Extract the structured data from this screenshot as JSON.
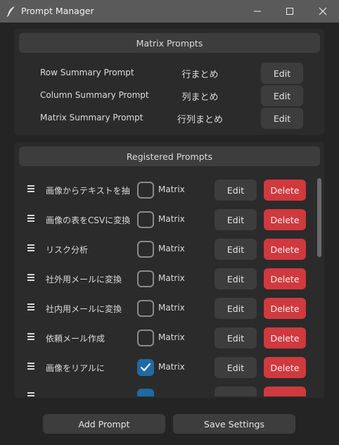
{
  "window": {
    "title": "Prompt Manager"
  },
  "matrix_section": {
    "title": "Matrix Prompts",
    "rows": [
      {
        "label": "Row Summary Prompt",
        "short": "行まとめ",
        "edit_label": "Edit"
      },
      {
        "label": "Column Summary Prompt",
        "short": "列まとめ",
        "edit_label": "Edit"
      },
      {
        "label": "Matrix Summary Prompt",
        "short": "行列まとめ",
        "edit_label": "Edit"
      }
    ]
  },
  "registered_section": {
    "title": "Registered Prompts",
    "prompts": [
      {
        "name": "画像からテキストを抽",
        "matrix_checked": false,
        "matrix_label": "Matrix",
        "edit_label": "Edit",
        "delete_label": "Delete"
      },
      {
        "name": "画像の表をCSVに変換",
        "matrix_checked": false,
        "matrix_label": "Matrix",
        "edit_label": "Edit",
        "delete_label": "Delete"
      },
      {
        "name": "リスク分析",
        "matrix_checked": false,
        "matrix_label": "Matrix",
        "edit_label": "Edit",
        "delete_label": "Delete"
      },
      {
        "name": "社外用メールに変換",
        "matrix_checked": false,
        "matrix_label": "Matrix",
        "edit_label": "Edit",
        "delete_label": "Delete"
      },
      {
        "name": "社内用メールに変換",
        "matrix_checked": false,
        "matrix_label": "Matrix",
        "edit_label": "Edit",
        "delete_label": "Delete"
      },
      {
        "name": "依頼メール作成",
        "matrix_checked": false,
        "matrix_label": "Matrix",
        "edit_label": "Edit",
        "delete_label": "Delete"
      },
      {
        "name": "画像をリアルに",
        "matrix_checked": true,
        "matrix_label": "Matrix",
        "edit_label": "Edit",
        "delete_label": "Delete"
      },
      {
        "name": "",
        "matrix_checked": true,
        "matrix_label": "",
        "edit_label": "",
        "delete_label": ""
      }
    ]
  },
  "footer": {
    "add_label": "Add Prompt",
    "save_label": "Save Settings"
  },
  "colors": {
    "accent": "#1f6aa5",
    "delete": "#d0393e",
    "titlebar": "#5a5a5a",
    "background": "#242424",
    "panel": "#2b2b2b",
    "button": "#3d3d3d"
  },
  "icons": {
    "app": "feather-quill-icon",
    "minimize": "minimize-icon",
    "maximize": "maximize-icon",
    "close": "close-icon",
    "drag": "drag-handle-icon",
    "check": "checkmark-icon"
  }
}
